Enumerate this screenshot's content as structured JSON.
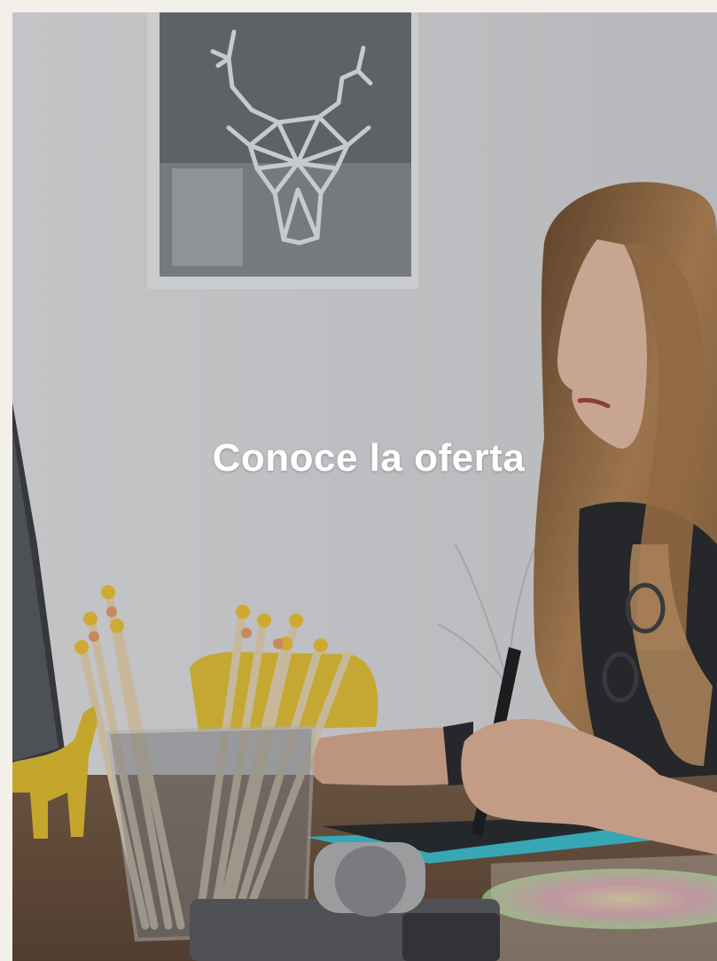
{
  "banner": {
    "headline": "Conoce la oferta",
    "overlay_color": "#000000"
  },
  "icons": {
    "deer_art": "deer-head-geometric"
  }
}
